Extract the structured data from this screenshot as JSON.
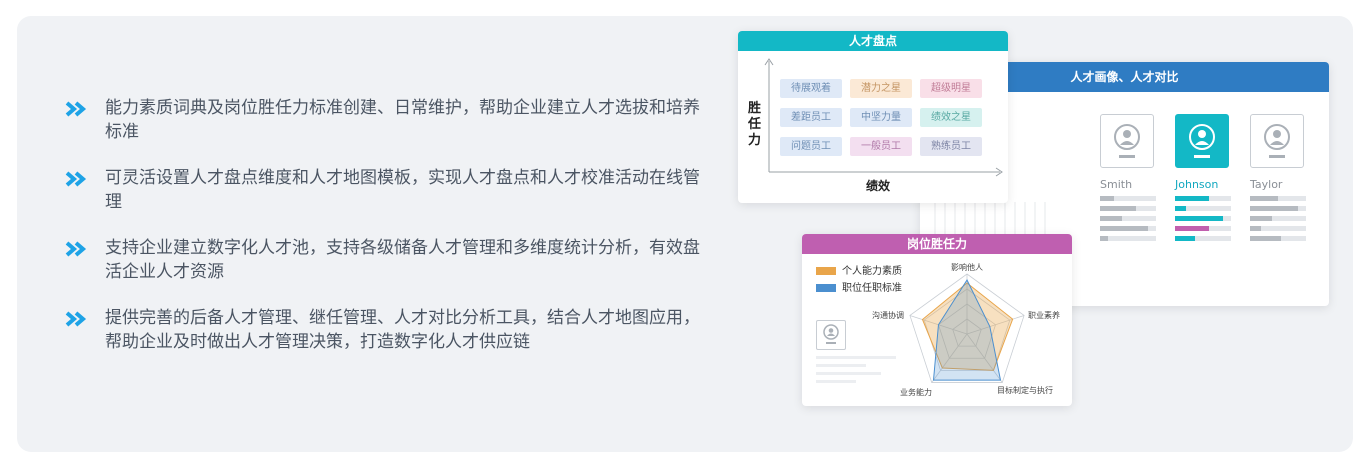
{
  "features": [
    "能力素质词典及岗位胜任力标准创建、日常维护，帮助企业建立人才选拔和培养标准",
    "可灵活设置人才盘点维度和人才地图模板，实现人才盘点和人才校准活动在线管理",
    "支持企业建立数字化人才池，支持各级储备人才管理和多维度统计分析，有效盘活企业人才资源",
    "提供完善的后备人才管理、继任管理、人才对比分析工具，结合人才地图应用，帮助企业及时做出人才管理决策，打造数字化人才供应链"
  ],
  "talent_map": {
    "title": "人才盘点",
    "y_label": "胜任力",
    "x_label": "绩效",
    "cells": [
      [
        "待展观着",
        "潜力之星",
        "超级明星"
      ],
      [
        "差距员工",
        "中坚力量",
        "绩效之星"
      ],
      [
        "问题员工",
        "一般员工",
        "熟练员工"
      ]
    ]
  },
  "compare": {
    "title": "人才画像、人才对比",
    "people": [
      {
        "name": "Smith",
        "selected": false,
        "bars": [
          0.25,
          0.65,
          0.4,
          0.85,
          0.15
        ]
      },
      {
        "name": "Johnson",
        "selected": true,
        "bars": [
          0.6,
          0.2,
          0.85,
          0.6,
          0.35
        ]
      },
      {
        "name": "Taylor",
        "selected": false,
        "bars": [
          0.5,
          0.85,
          0.4,
          0.2,
          0.55
        ]
      }
    ]
  },
  "competency": {
    "title": "岗位胜任力",
    "legend": [
      "个人能力素质",
      "职位任职标准"
    ],
    "axes": [
      "影响他人",
      "职业素养",
      "目标制定与执行",
      "业务能力",
      "沟通协调"
    ],
    "colors": {
      "personal": "#e9a54a",
      "standard": "#4b8fcf"
    }
  }
}
